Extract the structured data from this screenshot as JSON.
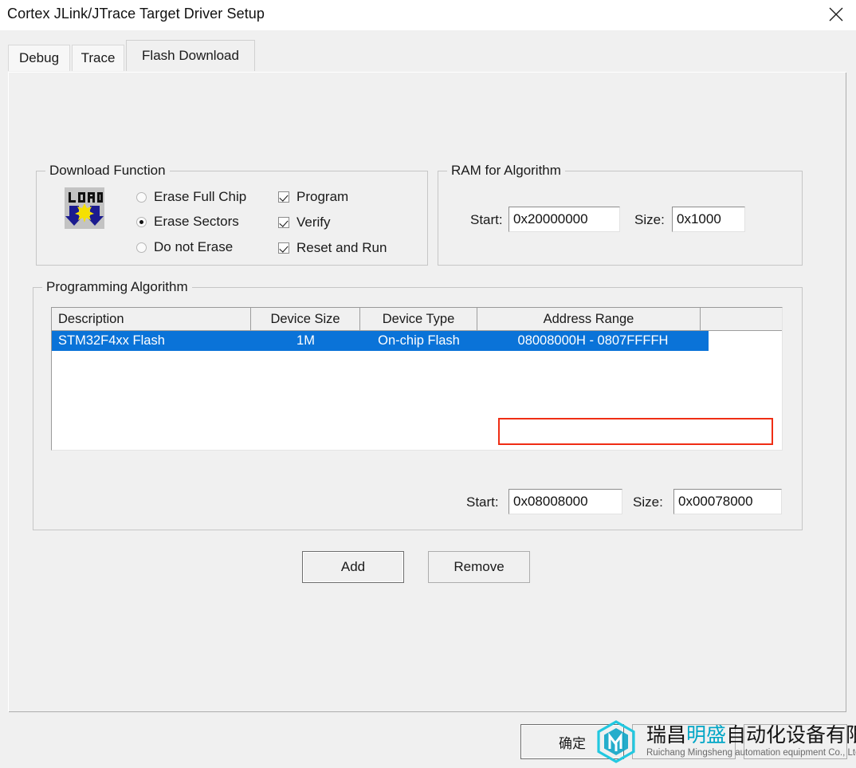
{
  "window": {
    "title": "Cortex JLink/JTrace Target Driver Setup",
    "close_icon": "close-icon"
  },
  "tabs": [
    {
      "label": "Debug",
      "active": false
    },
    {
      "label": "Trace",
      "active": false
    },
    {
      "label": "Flash Download",
      "active": true
    }
  ],
  "download_function": {
    "legend": "Download Function",
    "icon": "load-icon",
    "radios": [
      {
        "label": "Erase Full Chip",
        "selected": false
      },
      {
        "label": "Erase Sectors",
        "selected": true
      },
      {
        "label": "Do not Erase",
        "selected": false
      }
    ],
    "checkboxes": [
      {
        "label": "Program",
        "checked": true
      },
      {
        "label": "Verify",
        "checked": true
      },
      {
        "label": "Reset and Run",
        "checked": true
      }
    ]
  },
  "ram_for_algorithm": {
    "legend": "RAM for Algorithm",
    "start_label": "Start:",
    "start_value": "0x20000000",
    "size_label": "Size:",
    "size_value": "0x1000"
  },
  "programming_algorithm": {
    "legend": "Programming Algorithm",
    "columns": [
      "Description",
      "Device Size",
      "Device Type",
      "Address Range"
    ],
    "rows": [
      {
        "description": "STM32F4xx Flash",
        "device_size": "1M",
        "device_type": "On-chip Flash",
        "address_range": "08008000H - 0807FFFFH",
        "selected": true
      }
    ],
    "start_label": "Start:",
    "start_value": "0x08008000",
    "size_label": "Size:",
    "size_value": "0x00078000",
    "highlight_color": "#ef2d14"
  },
  "actions": {
    "add_label": "Add",
    "remove_label": "Remove"
  },
  "footer": {
    "ok_label": "确定",
    "cancel_label": "",
    "help_label": ""
  },
  "watermark": {
    "cn_part1": "瑞昌",
    "cn_highlight": "明盛",
    "cn_part2": "自动化设备有限公司",
    "en": "Ruichang Mingsheng automation equipment Co., Ltd",
    "accent": "#00a6c6"
  },
  "theme": {
    "selection_blue": "#0a73d8",
    "window_bg": "#f0f0f0"
  }
}
